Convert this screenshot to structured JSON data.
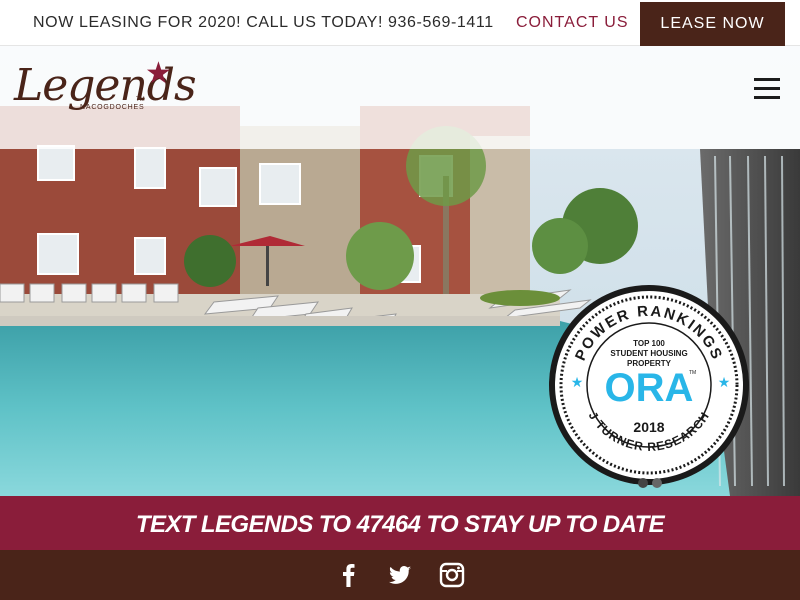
{
  "topbar": {
    "promo": "NOW LEASING FOR 2020! CALL US TODAY! 936-569-1411",
    "contact_label": "CONTACT US",
    "lease_label": "LEASE NOW"
  },
  "logo": {
    "script": "Legends",
    "subtitle": "NACOGDOCHES",
    "tm": "TM"
  },
  "header": {
    "menu_icon": "hamburger-icon"
  },
  "badge": {
    "top_text": "POWER RANKINGS",
    "line1": "TOP 100",
    "line2": "STUDENT HOUSING",
    "line3": "PROPERTY",
    "brand": "ORA",
    "tm": "TM",
    "year": "2018",
    "bottom_text": "J TURNER RESEARCH"
  },
  "slider": {
    "active_index": 0
  },
  "cta": {
    "text": "TEXT LEGENDS TO 47464 TO STAY UP TO DATE"
  },
  "social": {
    "items": [
      "facebook-icon",
      "twitter-icon",
      "instagram-icon"
    ]
  },
  "colors": {
    "maroon": "#8a1d3a",
    "brown": "#4a2419",
    "accent_blue": "#29b6e8"
  }
}
